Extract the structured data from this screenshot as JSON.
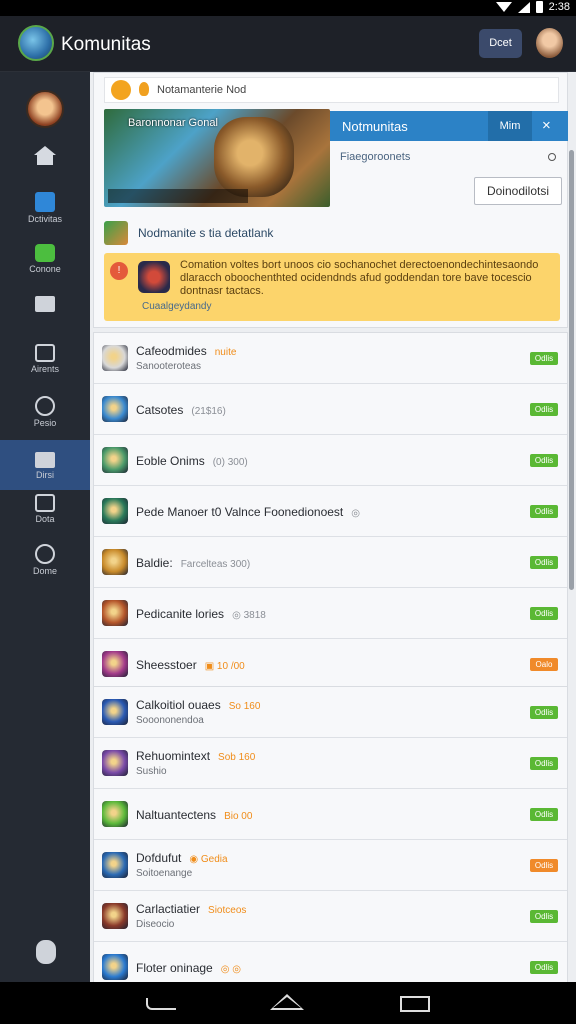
{
  "app": {
    "title": "Komunitas",
    "header_button": "Dcet"
  },
  "status": {
    "clock": "2:38"
  },
  "sidebar": {
    "items": [
      {
        "label": ""
      },
      {
        "label": "Dctivitas"
      },
      {
        "label": "Conone"
      },
      {
        "label": ""
      },
      {
        "label": "Airents"
      },
      {
        "label": "Pesio"
      },
      {
        "label": "Dirsi"
      },
      {
        "label": "Dota"
      },
      {
        "label": "Dome"
      }
    ]
  },
  "notification": {
    "text": "Notamanterie Nod"
  },
  "banner": {
    "caption": "Baronnonar Gonal"
  },
  "popup": {
    "title": "Notmunitas",
    "button": "Mim",
    "close": "×",
    "subtitle": "Fiaegoroonets",
    "action": "Doinodilotsi"
  },
  "section": {
    "title": "Nodmanite s tia detatlank",
    "alert_text": "Comation voltes bort unoos cio sochanochet derectoenondechintesaondo dlaracch oboochenthted ocidendnds afud goddendan tore bave tocescio dontnasr tactacs.",
    "alert_link": "Cuaalgeydandy"
  },
  "list_top": [
    {
      "title": "Cafeodmides",
      "meta": "nuite",
      "meta_color": "orange",
      "sub": "Sanooteroteas",
      "badge": "Odlis",
      "badge_color": "#5ab834",
      "icon": "#d8d8d8"
    },
    {
      "title": "Catsotes",
      "meta": "(21$16)",
      "meta_color": "grey",
      "sub": "",
      "badge": "Odlis",
      "badge_color": "#5ab834",
      "icon": "#3a8ad0"
    },
    {
      "title": "Eoble Onims",
      "meta": "(0) 300)",
      "meta_color": "grey",
      "sub": "",
      "badge": "Odlis",
      "badge_color": "#5ab834",
      "icon": "#4a9a6a"
    },
    {
      "title": "Pede Manoer t0 Valnce Foonedionoest",
      "meta": "◎",
      "meta_color": "grey",
      "sub": "",
      "badge": "Odlis",
      "badge_color": "#5ab834",
      "icon": "#2a7a5a"
    },
    {
      "title": "Baldie:",
      "meta": "Farcelteas 300)",
      "meta_color": "grey",
      "sub": "",
      "badge": "Odlis",
      "badge_color": "#5ab834",
      "icon": "#c88a2a"
    },
    {
      "title": "Pedicanite lories",
      "meta": "◎ 3818",
      "meta_color": "grey",
      "sub": "",
      "badge": "Odlis",
      "badge_color": "#5ab834",
      "icon": "#b4552a"
    },
    {
      "title": "Sheesstoer",
      "meta": "▣ 10 /00",
      "meta_color": "orange",
      "sub": "",
      "badge": "Oalo",
      "badge_color": "#f08a2a",
      "icon": "#a23a8a"
    }
  ],
  "list_bottom": [
    {
      "title": "Calkoitiol ouaes",
      "meta": "So 160",
      "meta_color": "orange",
      "sub": "Sooononendoa",
      "badge": "Odlis",
      "badge_color": "#5ab834",
      "icon": "#2a5ab4"
    },
    {
      "title": "Rehuomintext",
      "meta": "Sob 160",
      "meta_color": "orange",
      "sub": "Sushio",
      "badge": "Odlis",
      "badge_color": "#5ab834",
      "icon": "#7a4aa8"
    },
    {
      "title": "Naltuantectens",
      "meta": "Bio 00",
      "meta_color": "orange",
      "sub": "",
      "badge": "Odlis",
      "badge_color": "#5ab834",
      "icon": "#5ab83a"
    },
    {
      "title": "Dofdufut",
      "meta": "◉ Gedia",
      "meta_color": "orange",
      "sub": "Soitoenange",
      "badge": "Odlis",
      "badge_color": "#f08a2a",
      "icon": "#2a6ab4"
    },
    {
      "title": "Carlactiatier",
      "meta": "Siotceos",
      "meta_color": "orange",
      "sub": "Diseocio",
      "badge": "Odlis",
      "badge_color": "#5ab834",
      "icon": "#8a3a2a"
    },
    {
      "title": "Floter oninage",
      "meta": "◎ ◎",
      "meta_color": "orange",
      "sub": "",
      "badge": "Odlis",
      "badge_color": "#5ab834",
      "icon": "#2a7ad0"
    }
  ]
}
